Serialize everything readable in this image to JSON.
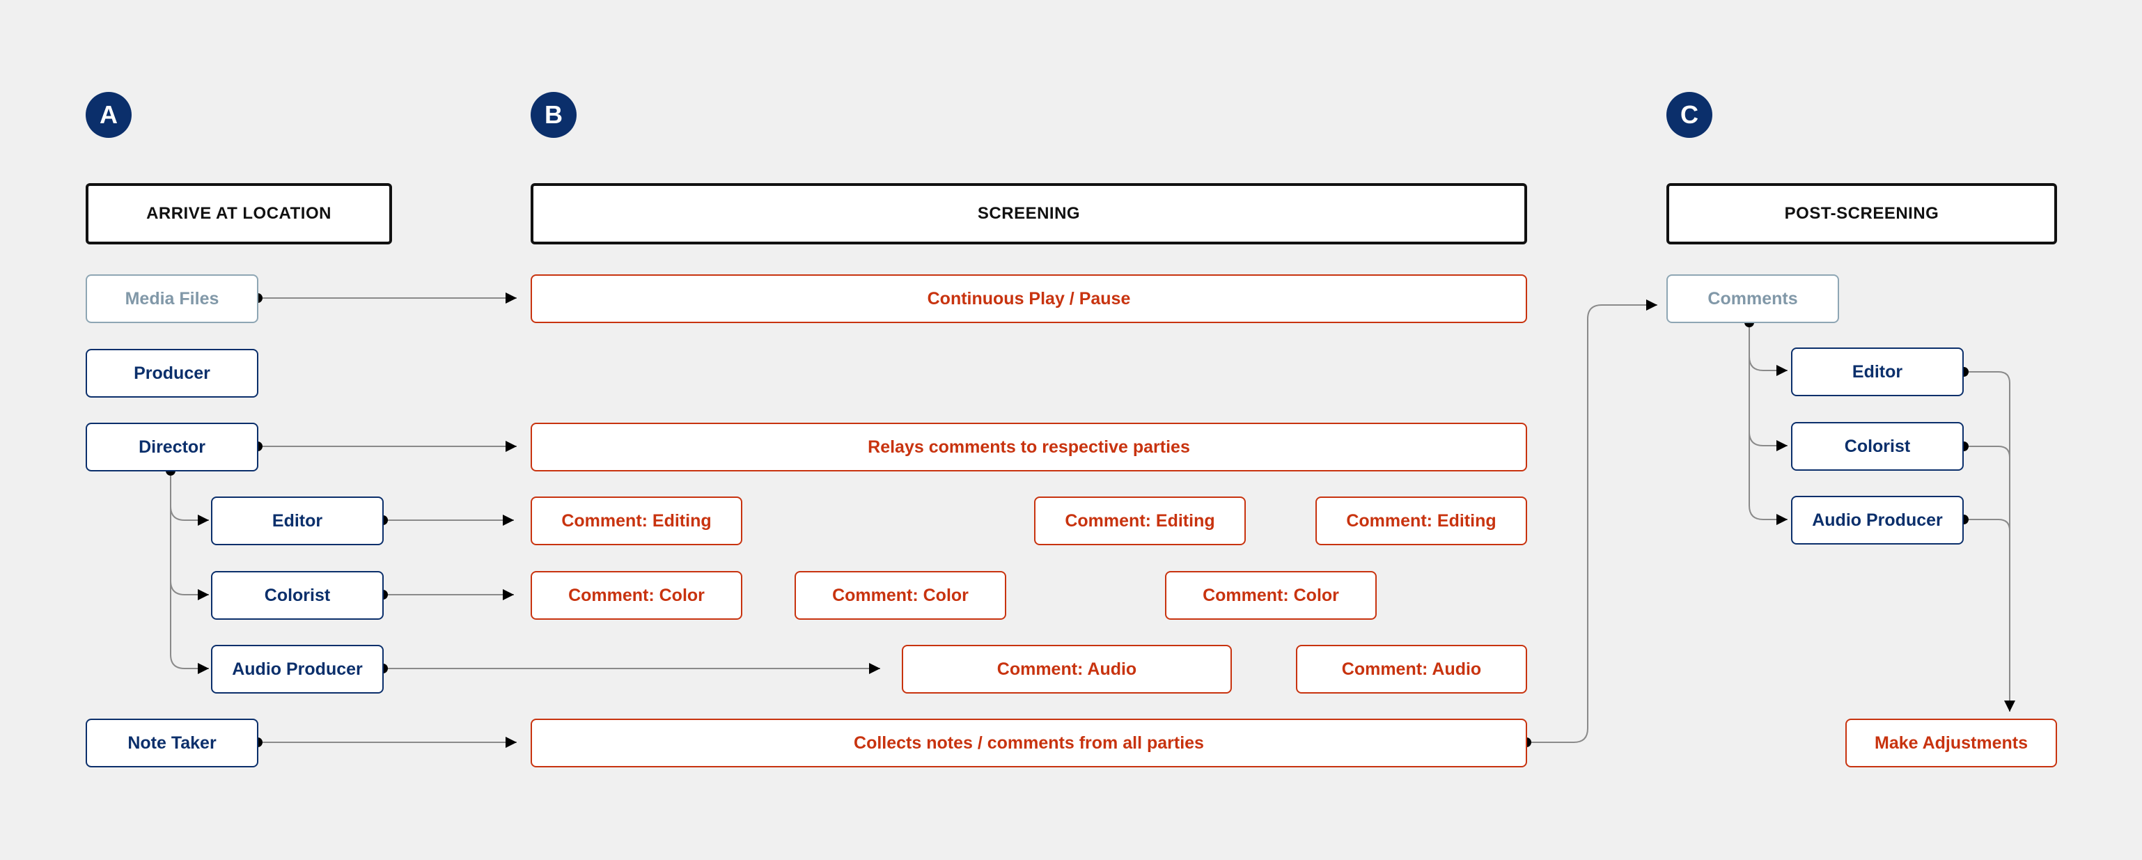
{
  "columns": [
    {
      "badge": "A",
      "header": "ARRIVE AT LOCATION"
    },
    {
      "badge": "B",
      "header": "SCREENING"
    },
    {
      "badge": "C",
      "header": "POST-SCREENING"
    }
  ],
  "a": {
    "media_files": "Media Files",
    "producer": "Producer",
    "director": "Director",
    "editor": "Editor",
    "colorist": "Colorist",
    "audio_producer": "Audio Producer",
    "note_taker": "Note Taker"
  },
  "b": {
    "play_pause": "Continuous Play / Pause",
    "relays": "Relays comments to respective parties",
    "editing_comments": [
      "Comment: Editing",
      "Comment: Editing",
      "Comment: Editing"
    ],
    "color_comments": [
      "Comment: Color",
      "Comment: Color",
      "Comment: Color"
    ],
    "audio_comments": [
      "Comment: Audio",
      "Comment: Audio"
    ],
    "collects": "Collects notes / comments from all parties"
  },
  "c": {
    "comments": "Comments",
    "editor": "Editor",
    "colorist": "Colorist",
    "audio_producer": "Audio Producer",
    "make_adjustments": "Make Adjustments"
  },
  "colors": {
    "background": "#f0f0f0",
    "badge": "#0b2f6b",
    "role": "#0b2f6b",
    "action": "#c8330f",
    "muted": "#8198a8",
    "connector": "#888888"
  }
}
